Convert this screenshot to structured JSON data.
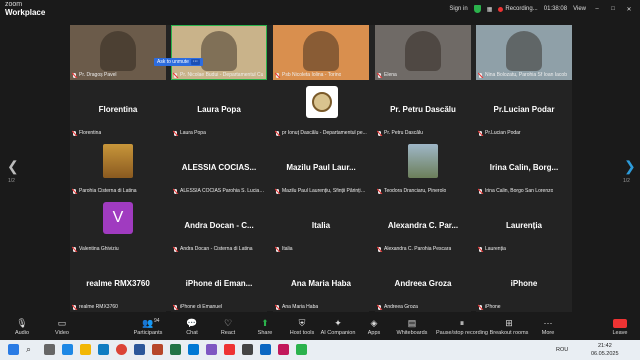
{
  "app": {
    "brand_top": "zoom",
    "brand_bottom": "Workplace"
  },
  "topbar": {
    "sign_in": "Sign in",
    "recording": "Recording...",
    "timer": "01:38:08",
    "view": "View"
  },
  "unmute_chip": {
    "label": "Ask to unmute",
    "more": "···"
  },
  "pager": {
    "left": "1/2",
    "right": "1/2"
  },
  "rows": [
    [
      {
        "type": "video",
        "display": "",
        "caption": "Pr. Dragoș Pavel"
      },
      {
        "type": "video",
        "display": "",
        "caption": "Pr. Nicolae Budui - Departamentul Cu",
        "active": true
      },
      {
        "type": "video",
        "display": "",
        "caption": "Psb Nicoleta Iolina - Torino"
      },
      {
        "type": "video",
        "display": "",
        "caption": "Elena"
      },
      {
        "type": "video",
        "display": "",
        "caption": "Nina Bolozatu, Parohia Sf Ioan Iacob"
      }
    ],
    [
      {
        "type": "name",
        "display": "Florentina",
        "caption": "Florentina"
      },
      {
        "type": "name",
        "display": "Laura Popa",
        "caption": "Laura Popa"
      },
      {
        "type": "logo",
        "display": "",
        "caption": "pr Ionuț Dascălu - Departamentul pe..."
      },
      {
        "type": "name",
        "display": "Pr. Petru Dascălu",
        "caption": "Pr. Petru Dascălu"
      },
      {
        "type": "name",
        "display": "Pr.Lucian Podar",
        "caption": "Pr.Lucian Podar"
      }
    ],
    [
      {
        "type": "photo",
        "display": "",
        "caption": "Parohia Cisterna di Latina"
      },
      {
        "type": "name",
        "display": "ALESSIA COCIAS...",
        "caption": "ALESSIA COCIAS Parohia S. Lucia, Zel..."
      },
      {
        "type": "name",
        "display": "Mazilu Paul Laur...",
        "caption": "Mazilu Paul Laurențiu, Sfinții Părinți I..."
      },
      {
        "type": "photo2",
        "display": "",
        "caption": "Teodora Dranciaru, Pinerolo"
      },
      {
        "type": "name",
        "display": "Irina Calin, Borg...",
        "caption": "Irina Calin, Borgo San Lorenzo"
      }
    ],
    [
      {
        "type": "letter",
        "display": "V",
        "caption": "Valentina Ghiviziu"
      },
      {
        "type": "name",
        "display": "Andra Docan - C...",
        "caption": "Andra Docan - Cisterna di Latina"
      },
      {
        "type": "name",
        "display": "Italia",
        "caption": "Italia"
      },
      {
        "type": "name",
        "display": "Alexandra C. Par...",
        "caption": "Alexandra C. Parohia Pescara"
      },
      {
        "type": "name",
        "display": "Laurenția",
        "caption": "Laurenția"
      }
    ],
    [
      {
        "type": "name",
        "display": "realme RMX3760",
        "caption": "realme RMX3760"
      },
      {
        "type": "name",
        "display": "iPhone di Eman...",
        "caption": "iPhone di Emanuel"
      },
      {
        "type": "name",
        "display": "Ana Maria Haba",
        "caption": "Ana Maria Haba"
      },
      {
        "type": "name",
        "display": "Andreea Groza",
        "caption": "Andreea Groza"
      },
      {
        "type": "name",
        "display": "iPhone",
        "caption": "iPhone"
      }
    ]
  ],
  "toolbar": {
    "audio": "Audio",
    "video": "Video",
    "participants": "Participants",
    "participants_count": "94",
    "chat": "Chat",
    "react": "React",
    "share": "Share",
    "host_tools": "Host tools",
    "ai_companion": "AI Companion",
    "apps": "Apps",
    "whiteboards": "Whiteboards",
    "pause_recording": "Pause/stop recording",
    "breakout": "Breakout rooms",
    "more": "More",
    "leave": "Leave"
  },
  "taskbar": {
    "lang": "ROU",
    "time": "21:42",
    "date": "06.05.2025"
  },
  "colors": {
    "active": "#2bb24c",
    "leave": "#e33",
    "chip": "#2d6cdf"
  }
}
